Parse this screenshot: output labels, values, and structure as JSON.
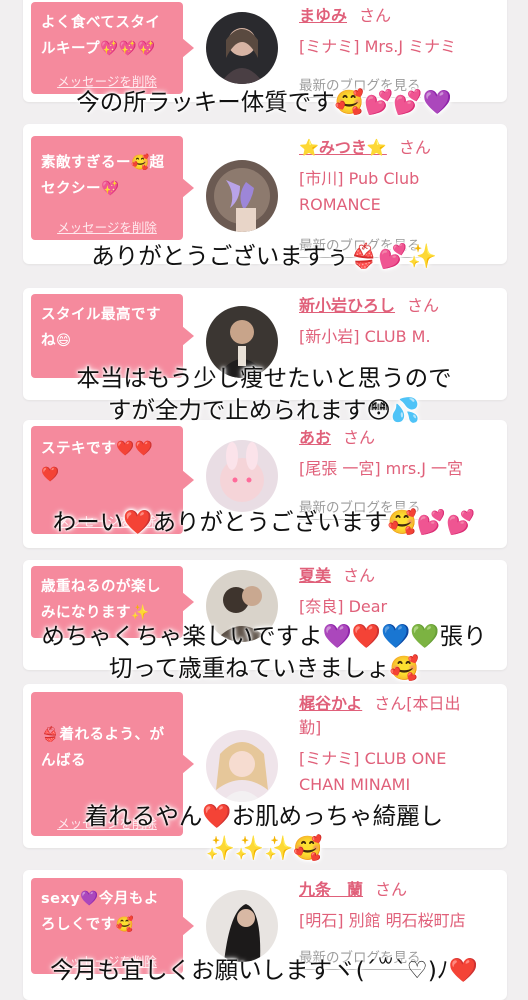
{
  "accent_color": "#f58a9d",
  "link_color": "#e0607a",
  "delete_label": "メッセージを削除",
  "blog_label": "最新のブログを見る",
  "suffix": "さん",
  "cards": [
    {
      "message": "よく食べてスタイ\nルキープ💖💖💖",
      "name": "まゆみ",
      "suffix": "さん",
      "shop": "[ミナミ] Mrs.J ミナミ",
      "reply": "今の所ラッキー体質です🥰💕💕💜"
    },
    {
      "message": "素敵すぎるー🥰超\nセクシー💖",
      "name": "⭐みつき⭐",
      "suffix": "さん",
      "shop": "[市川] Pub Club\nROMANCE",
      "reply": "ありがとうございますぅ👙💕✨"
    },
    {
      "message": "スタイル最高です\nね😄",
      "name": "新小岩ひろし",
      "suffix": "さん",
      "shop": "[新小岩] CLUB M.",
      "reply": "本当はもう少し痩せたいと思うので\nすが全力で止められます😳💦"
    },
    {
      "message": "ステキです❤️❤️\n❤️",
      "name": "あお",
      "suffix": "さん",
      "shop": "[尾張 一宮] mrs.J 一宮",
      "reply": "わーい❤️ありがとうございます🥰💕💕"
    },
    {
      "message": "歳重ねるのが楽し\nみになります✨",
      "name": "夏美",
      "suffix": "さん",
      "shop": "[奈良] Dear",
      "reply": "めちゃくちゃ楽しいですよ💜❤️💙💚張り\n切って歳重ねていきましょ🥰"
    },
    {
      "message": "👙着れるよう、が\nんばる",
      "name": "梶谷かよ",
      "suffix": "さん[本日出\n勤]",
      "shop": "[ミナミ] CLUB ONE\nCHAN MINAMI",
      "reply": "着れるやん❤️お肌めっちゃ綺麗し\n✨✨✨🥰"
    },
    {
      "message": "sexy💜今月もよ\nろしくです🥰",
      "name": "九条　蘭",
      "suffix": "さん",
      "shop": "[明石] 別館 明石桜町店",
      "reply": "今月も宜しくお願いしますヾ(´꒳`♡)ﾉ❤️"
    }
  ]
}
